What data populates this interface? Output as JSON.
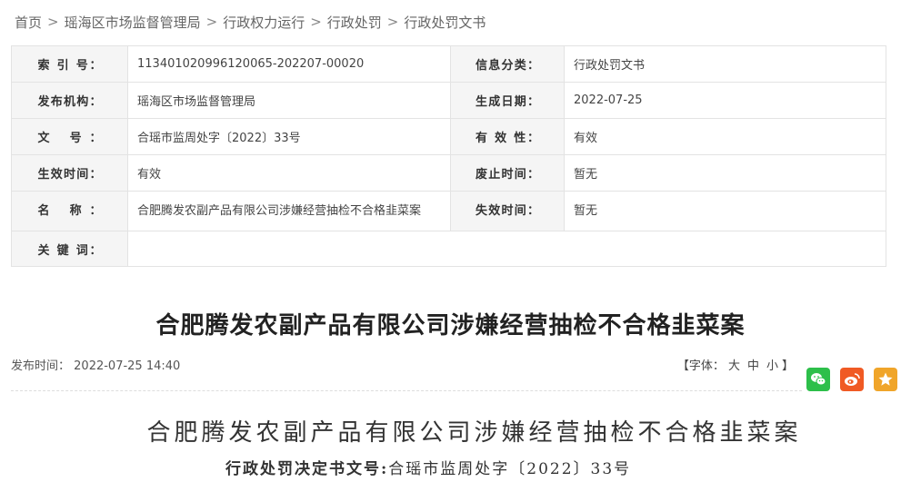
{
  "breadcrumb": [
    "首页",
    "瑶海区市场监督管理局",
    "行政权力运行",
    "行政处罚",
    "行政处罚文书"
  ],
  "breadcrumb_sep": ">",
  "info_table": {
    "index_label": "索 引 号：",
    "index_value": "113401020996120065-202207-00020",
    "category_label": "信息分类：",
    "category_value": "行政处罚文书",
    "publisher_label": "发布机构：",
    "publisher_value": "瑶海区市场监督管理局",
    "created_label": "生成日期：",
    "created_value": "2022-07-25",
    "docno_label": "文 号：",
    "docno_value": "合瑶市监周处字〔2022〕33号",
    "validity_label": "有 效 性：",
    "validity_value": "有效",
    "effective_label": "生效时间：",
    "effective_value": "有效",
    "repeal_label": "废止时间：",
    "repeal_value": "暂无",
    "name_label": "名 称：",
    "name_value": "合肥腾发农副产品有限公司涉嫌经营抽检不合格韭菜案",
    "expire_label": "失效时间：",
    "expire_value": "暂无",
    "keywords_label": "关 键 词：",
    "keywords_value": ""
  },
  "article": {
    "title": "合肥腾发农副产品有限公司涉嫌经营抽检不合格韭菜案",
    "publish_label": "发布时间：",
    "publish_time": "2022-07-25 14:40",
    "font_prefix": "【字体：",
    "font_large": "大",
    "font_medium": "中",
    "font_small": "小",
    "font_suffix": "】"
  },
  "share": {
    "wechat_icon": "wechat-icon",
    "weibo_icon": "weibo-icon",
    "favorite_icon": "star-icon"
  },
  "document": {
    "heading": "合肥腾发农副产品有限公司涉嫌经营抽检不合格韭菜案",
    "number_label": "行政处罚决定书文号:",
    "number_value": "合瑶市监周处字〔2022〕33号"
  }
}
